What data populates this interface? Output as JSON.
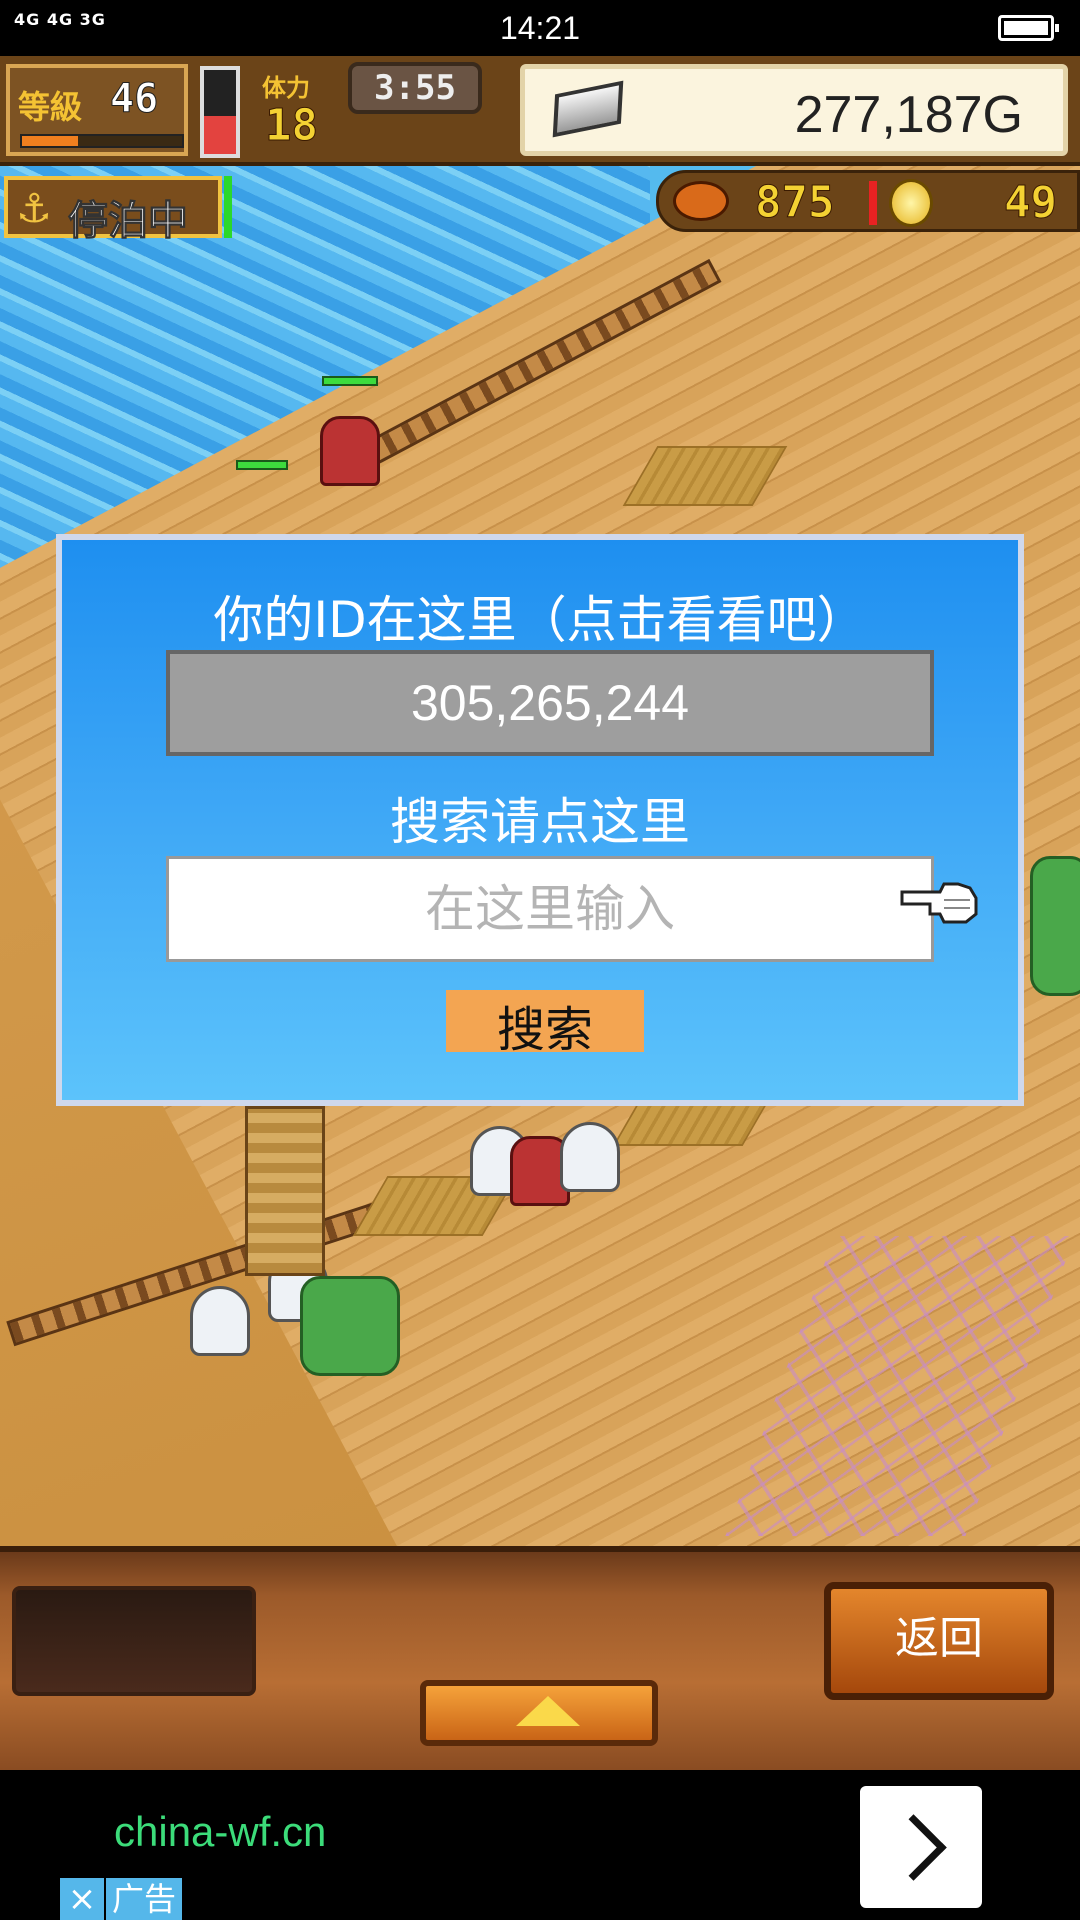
{
  "status_bar": {
    "network": "4G 4G 3G",
    "time": "14:21"
  },
  "hud": {
    "level_label": "等級",
    "level_value": "46",
    "exp_fraction": 0.35,
    "stamina_label": "体力",
    "stamina_value": "18",
    "stamina_fraction": 0.45,
    "timer": "3:55",
    "gold": "277,187G",
    "anchor_status": "停泊中",
    "meat": "875",
    "coins": "49"
  },
  "dialog": {
    "title": "你的ID在这里（点击看看吧）",
    "id_value": "305,265,244",
    "search_label": "搜索请点这里",
    "input_placeholder": "在这里输入",
    "search_button": "搜索"
  },
  "controls": {
    "back_button": "返回"
  },
  "ad": {
    "url": "china-wf.cn",
    "close_glyph": "×",
    "label": "广告"
  },
  "colors": {
    "dialog_bg": "#3fa8f6",
    "search_button_bg": "#f3a552",
    "ad_url": "#3cdc7a"
  }
}
